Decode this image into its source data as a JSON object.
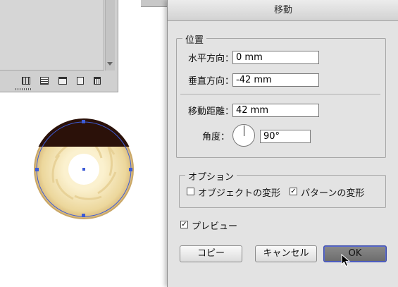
{
  "dialog": {
    "title": "移動",
    "position_group": {
      "title": "位置",
      "horizontal_label": "水平方向：",
      "horizontal_value": "0 mm",
      "vertical_label": "垂直方向：",
      "vertical_value": "-42 mm",
      "distance_label": "移動距離：",
      "distance_value": "42 mm",
      "angle_label": "角度：",
      "angle_value": "90°"
    },
    "options_group": {
      "title": "オプション",
      "transform_objects_label": "オブジェクトの変形",
      "transform_objects_checked": false,
      "transform_patterns_label": "パターンの変形",
      "transform_patterns_checked": true
    },
    "preview_label": "プレビュー",
    "preview_checked": true,
    "buttons": {
      "copy": "コピー",
      "cancel": "キャンセル",
      "ok": "OK"
    }
  },
  "colors": {
    "dialog_bg": "#e3e3e3",
    "chocolate": "#2b1109",
    "cookie": "#f1e2b2",
    "selection": "#3d5bd6"
  }
}
